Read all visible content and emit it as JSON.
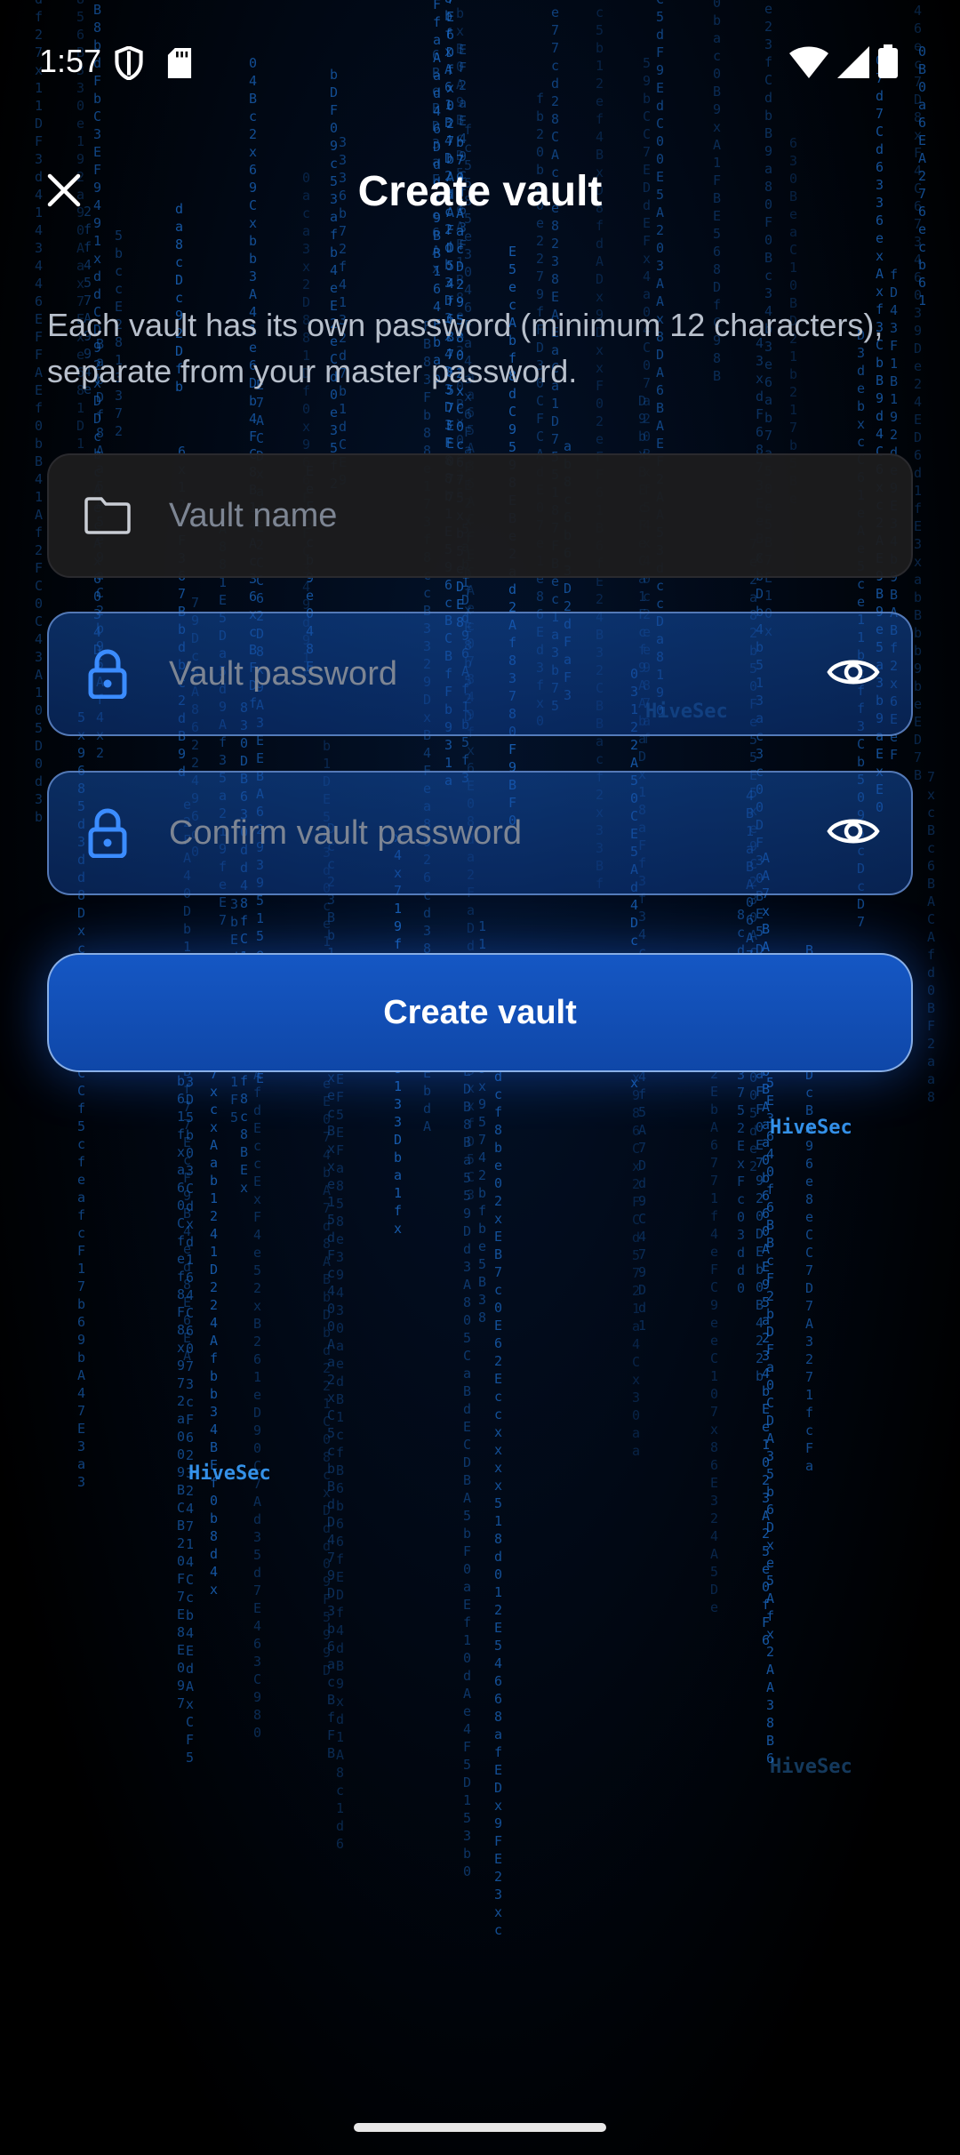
{
  "status_bar": {
    "time": "1:57",
    "icons": [
      "shield-icon",
      "sd-card-icon",
      "wifi-icon",
      "signal-icon",
      "battery-icon"
    ]
  },
  "app_bar": {
    "title": "Create vault",
    "close_icon": "close-icon"
  },
  "description": "Each vault has its own password (minimum 12 characters), separate from your master password.",
  "form": {
    "vault_name": {
      "placeholder": "Vault name",
      "value": "",
      "icon": "folder-icon"
    },
    "vault_password": {
      "placeholder": "Vault password",
      "value": "",
      "icon": "lock-icon",
      "toggle_icon": "eye-icon"
    },
    "confirm_password": {
      "placeholder": "Confirm vault password",
      "value": "",
      "icon": "lock-icon",
      "toggle_icon": "eye-icon"
    },
    "submit_label": "Create vault"
  },
  "background_text": [
    "HiveSec",
    "HiveSec",
    "HiveSec",
    "HiveSec"
  ],
  "colors": {
    "accent": "#1557c4",
    "rain": "#1c6fd0",
    "background": "#000000"
  }
}
